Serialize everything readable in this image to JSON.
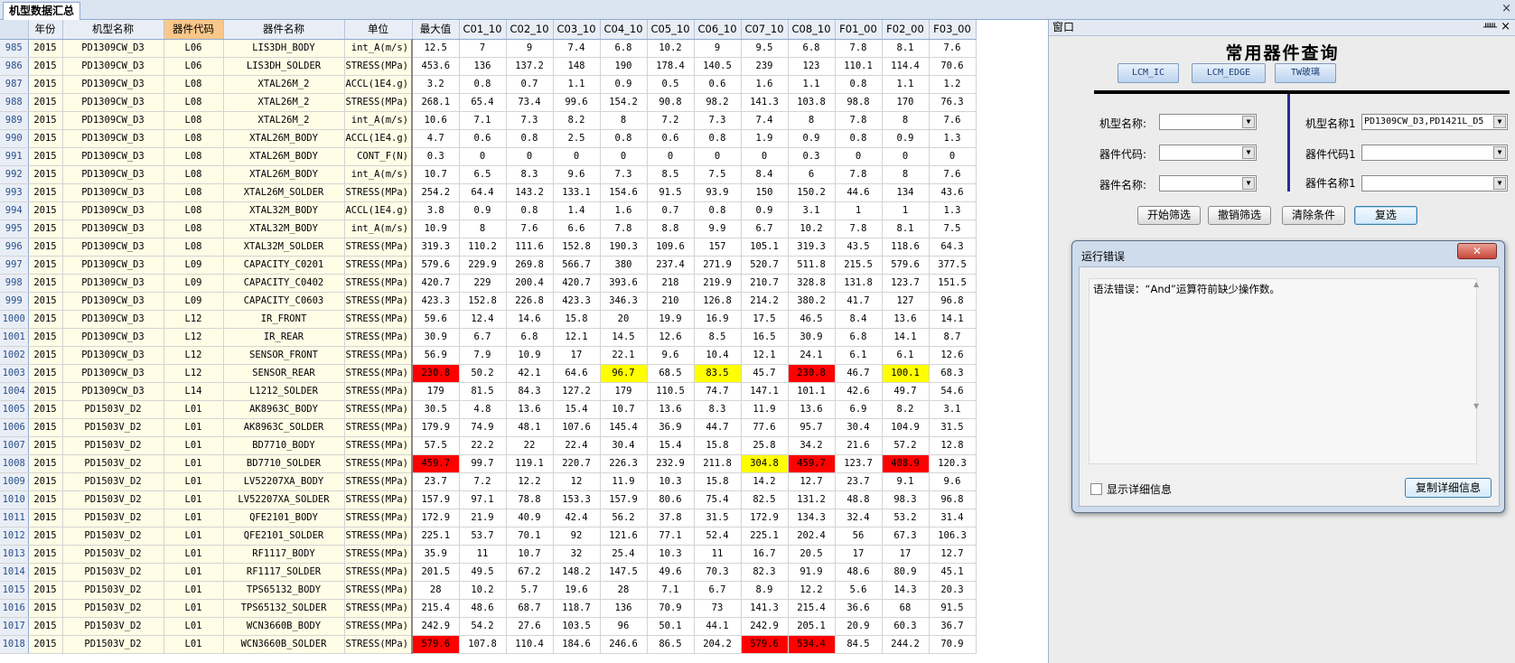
{
  "sheet_tab": "机型数据汇总",
  "columns": [
    "年份",
    "机型名称",
    "器件代码",
    "器件名称",
    "单位",
    "最大值",
    "C01_10",
    "C02_10",
    "C03_10",
    "C04_10",
    "C05_10",
    "C06_10",
    "C07_10",
    "C08_10",
    "F01_00",
    "F02_00",
    "F03_00"
  ],
  "rows": [
    {
      "n": "985",
      "c": [
        "2015",
        "PD1309CW_D3",
        "L06",
        "LIS3DH_BODY",
        "int_A(m/s)",
        "12.5",
        "7",
        "9",
        "7.4",
        "6.8",
        "10.2",
        "9",
        "9.5",
        "6.8",
        "7.8",
        "8.1",
        "7.6"
      ]
    },
    {
      "n": "986",
      "c": [
        "2015",
        "PD1309CW_D3",
        "L06",
        "LIS3DH_SOLDER",
        "STRESS(MPa)",
        "453.6",
        "136",
        "137.2",
        "148",
        "190",
        "178.4",
        "140.5",
        "239",
        "123",
        "110.1",
        "114.4",
        "70.6"
      ]
    },
    {
      "n": "987",
      "c": [
        "2015",
        "PD1309CW_D3",
        "L08",
        "XTAL26M_2",
        "ACCL(1E4.g)",
        "3.2",
        "0.8",
        "0.7",
        "1.1",
        "0.9",
        "0.5",
        "0.6",
        "1.6",
        "1.1",
        "0.8",
        "1.1",
        "1.2"
      ]
    },
    {
      "n": "988",
      "c": [
        "2015",
        "PD1309CW_D3",
        "L08",
        "XTAL26M_2",
        "STRESS(MPa)",
        "268.1",
        "65.4",
        "73.4",
        "99.6",
        "154.2",
        "90.8",
        "98.2",
        "141.3",
        "103.8",
        "98.8",
        "170",
        "76.3"
      ]
    },
    {
      "n": "989",
      "c": [
        "2015",
        "PD1309CW_D3",
        "L08",
        "XTAL26M_2",
        "int_A(m/s)",
        "10.6",
        "7.1",
        "7.3",
        "8.2",
        "8",
        "7.2",
        "7.3",
        "7.4",
        "8",
        "7.8",
        "8",
        "7.6"
      ]
    },
    {
      "n": "990",
      "c": [
        "2015",
        "PD1309CW_D3",
        "L08",
        "XTAL26M_BODY",
        "ACCL(1E4.g)",
        "4.7",
        "0.6",
        "0.8",
        "2.5",
        "0.8",
        "0.6",
        "0.8",
        "1.9",
        "0.9",
        "0.8",
        "0.9",
        "1.3"
      ]
    },
    {
      "n": "991",
      "c": [
        "2015",
        "PD1309CW_D3",
        "L08",
        "XTAL26M_BODY",
        "CONT_F(N)",
        "0.3",
        "0",
        "0",
        "0",
        "0",
        "0",
        "0",
        "0",
        "0.3",
        "0",
        "0",
        "0"
      ]
    },
    {
      "n": "992",
      "c": [
        "2015",
        "PD1309CW_D3",
        "L08",
        "XTAL26M_BODY",
        "int_A(m/s)",
        "10.7",
        "6.5",
        "8.3",
        "9.6",
        "7.3",
        "8.5",
        "7.5",
        "8.4",
        "6",
        "7.8",
        "8",
        "7.6"
      ]
    },
    {
      "n": "993",
      "c": [
        "2015",
        "PD1309CW_D3",
        "L08",
        "XTAL26M_SOLDER",
        "STRESS(MPa)",
        "254.2",
        "64.4",
        "143.2",
        "133.1",
        "154.6",
        "91.5",
        "93.9",
        "150",
        "150.2",
        "44.6",
        "134",
        "43.6"
      ]
    },
    {
      "n": "994",
      "c": [
        "2015",
        "PD1309CW_D3",
        "L08",
        "XTAL32M_BODY",
        "ACCL(1E4.g)",
        "3.8",
        "0.9",
        "0.8",
        "1.4",
        "1.6",
        "0.7",
        "0.8",
        "0.9",
        "3.1",
        "1",
        "1",
        "1.3"
      ]
    },
    {
      "n": "995",
      "c": [
        "2015",
        "PD1309CW_D3",
        "L08",
        "XTAL32M_BODY",
        "int_A(m/s)",
        "10.9",
        "8",
        "7.6",
        "6.6",
        "7.8",
        "8.8",
        "9.9",
        "6.7",
        "10.2",
        "7.8",
        "8.1",
        "7.5"
      ]
    },
    {
      "n": "996",
      "c": [
        "2015",
        "PD1309CW_D3",
        "L08",
        "XTAL32M_SOLDER",
        "STRESS(MPa)",
        "319.3",
        "110.2",
        "111.6",
        "152.8",
        "190.3",
        "109.6",
        "157",
        "105.1",
        "319.3",
        "43.5",
        "118.6",
        "64.3"
      ]
    },
    {
      "n": "997",
      "c": [
        "2015",
        "PD1309CW_D3",
        "L09",
        "CAPACITY_C0201",
        "STRESS(MPa)",
        "579.6",
        "229.9",
        "269.8",
        "566.7",
        "380",
        "237.4",
        "271.9",
        "520.7",
        "511.8",
        "215.5",
        "579.6",
        "377.5"
      ]
    },
    {
      "n": "998",
      "c": [
        "2015",
        "PD1309CW_D3",
        "L09",
        "CAPACITY_C0402",
        "STRESS(MPa)",
        "420.7",
        "229",
        "200.4",
        "420.7",
        "393.6",
        "218",
        "219.9",
        "210.7",
        "328.8",
        "131.8",
        "123.7",
        "151.5"
      ]
    },
    {
      "n": "999",
      "c": [
        "2015",
        "PD1309CW_D3",
        "L09",
        "CAPACITY_C0603",
        "STRESS(MPa)",
        "423.3",
        "152.8",
        "226.8",
        "423.3",
        "346.3",
        "210",
        "126.8",
        "214.2",
        "380.2",
        "41.7",
        "127",
        "96.8"
      ]
    },
    {
      "n": "1000",
      "c": [
        "2015",
        "PD1309CW_D3",
        "L12",
        "IR_FRONT",
        "STRESS(MPa)",
        "59.6",
        "12.4",
        "14.6",
        "15.8",
        "20",
        "19.9",
        "16.9",
        "17.5",
        "46.5",
        "8.4",
        "13.6",
        "14.1"
      ]
    },
    {
      "n": "1001",
      "c": [
        "2015",
        "PD1309CW_D3",
        "L12",
        "IR_REAR",
        "STRESS(MPa)",
        "30.9",
        "6.7",
        "6.8",
        "12.1",
        "14.5",
        "12.6",
        "8.5",
        "16.5",
        "30.9",
        "6.8",
        "14.1",
        "8.7"
      ]
    },
    {
      "n": "1002",
      "c": [
        "2015",
        "PD1309CW_D3",
        "L12",
        "SENSOR_FRONT",
        "STRESS(MPa)",
        "56.9",
        "7.9",
        "10.9",
        "17",
        "22.1",
        "9.6",
        "10.4",
        "12.1",
        "24.1",
        "6.1",
        "6.1",
        "12.6"
      ]
    },
    {
      "n": "1003",
      "c": [
        "2015",
        "PD1309CW_D3",
        "L12",
        "SENSOR_REAR",
        "STRESS(MPa)",
        "230.8",
        "50.2",
        "42.1",
        "64.6",
        "96.7",
        "68.5",
        "83.5",
        "45.7",
        "230.8",
        "46.7",
        "100.1",
        "68.3"
      ],
      "red": [
        5,
        13
      ],
      "yel": [
        9,
        11,
        15
      ]
    },
    {
      "n": "1004",
      "c": [
        "2015",
        "PD1309CW_D3",
        "L14",
        "L1212_SOLDER",
        "STRESS(MPa)",
        "179",
        "81.5",
        "84.3",
        "127.2",
        "179",
        "110.5",
        "74.7",
        "147.1",
        "101.1",
        "42.6",
        "49.7",
        "54.6"
      ]
    },
    {
      "n": "1005",
      "c": [
        "2015",
        "PD1503V_D2",
        "L01",
        "AK8963C_BODY",
        "STRESS(MPa)",
        "30.5",
        "4.8",
        "13.6",
        "15.4",
        "10.7",
        "13.6",
        "8.3",
        "11.9",
        "13.6",
        "6.9",
        "8.2",
        "3.1"
      ]
    },
    {
      "n": "1006",
      "c": [
        "2015",
        "PD1503V_D2",
        "L01",
        "AK8963C_SOLDER",
        "STRESS(MPa)",
        "179.9",
        "74.9",
        "48.1",
        "107.6",
        "145.4",
        "36.9",
        "44.7",
        "77.6",
        "95.7",
        "30.4",
        "104.9",
        "31.5"
      ]
    },
    {
      "n": "1007",
      "c": [
        "2015",
        "PD1503V_D2",
        "L01",
        "BD7710_BODY",
        "STRESS(MPa)",
        "57.5",
        "22.2",
        "22",
        "22.4",
        "30.4",
        "15.4",
        "15.8",
        "25.8",
        "34.2",
        "21.6",
        "57.2",
        "12.8"
      ]
    },
    {
      "n": "1008",
      "c": [
        "2015",
        "PD1503V_D2",
        "L01",
        "BD7710_SOLDER",
        "STRESS(MPa)",
        "459.7",
        "99.7",
        "119.1",
        "220.7",
        "226.3",
        "232.9",
        "211.8",
        "304.8",
        "459.7",
        "123.7",
        "408.9",
        "120.3"
      ],
      "red": [
        5,
        13,
        15
      ],
      "yel": [
        12
      ]
    },
    {
      "n": "1009",
      "c": [
        "2015",
        "PD1503V_D2",
        "L01",
        "LV52207XA_BODY",
        "STRESS(MPa)",
        "23.7",
        "7.2",
        "12.2",
        "12",
        "11.9",
        "10.3",
        "15.8",
        "14.2",
        "12.7",
        "23.7",
        "9.1",
        "9.6"
      ]
    },
    {
      "n": "1010",
      "c": [
        "2015",
        "PD1503V_D2",
        "L01",
        "LV52207XA_SOLDER",
        "STRESS(MPa)",
        "157.9",
        "97.1",
        "78.8",
        "153.3",
        "157.9",
        "80.6",
        "75.4",
        "82.5",
        "131.2",
        "48.8",
        "98.3",
        "96.8"
      ]
    },
    {
      "n": "1011",
      "c": [
        "2015",
        "PD1503V_D2",
        "L01",
        "QFE2101_BODY",
        "STRESS(MPa)",
        "172.9",
        "21.9",
        "40.9",
        "42.4",
        "56.2",
        "37.8",
        "31.5",
        "172.9",
        "134.3",
        "32.4",
        "53.2",
        "31.4"
      ]
    },
    {
      "n": "1012",
      "c": [
        "2015",
        "PD1503V_D2",
        "L01",
        "QFE2101_SOLDER",
        "STRESS(MPa)",
        "225.1",
        "53.7",
        "70.1",
        "92",
        "121.6",
        "77.1",
        "52.4",
        "225.1",
        "202.4",
        "56",
        "67.3",
        "106.3"
      ]
    },
    {
      "n": "1013",
      "c": [
        "2015",
        "PD1503V_D2",
        "L01",
        "RF1117_BODY",
        "STRESS(MPa)",
        "35.9",
        "11",
        "10.7",
        "32",
        "25.4",
        "10.3",
        "11",
        "16.7",
        "20.5",
        "17",
        "17",
        "12.7"
      ]
    },
    {
      "n": "1014",
      "c": [
        "2015",
        "PD1503V_D2",
        "L01",
        "RF1117_SOLDER",
        "STRESS(MPa)",
        "201.5",
        "49.5",
        "67.2",
        "148.2",
        "147.5",
        "49.6",
        "70.3",
        "82.3",
        "91.9",
        "48.6",
        "80.9",
        "45.1"
      ]
    },
    {
      "n": "1015",
      "c": [
        "2015",
        "PD1503V_D2",
        "L01",
        "TPS65132_BODY",
        "STRESS(MPa)",
        "28",
        "10.2",
        "5.7",
        "19.6",
        "28",
        "7.1",
        "6.7",
        "8.9",
        "12.2",
        "5.6",
        "14.3",
        "20.3"
      ]
    },
    {
      "n": "1016",
      "c": [
        "2015",
        "PD1503V_D2",
        "L01",
        "TPS65132_SOLDER",
        "STRESS(MPa)",
        "215.4",
        "48.6",
        "68.7",
        "118.7",
        "136",
        "70.9",
        "73",
        "141.3",
        "215.4",
        "36.6",
        "68",
        "91.5"
      ]
    },
    {
      "n": "1017",
      "c": [
        "2015",
        "PD1503V_D2",
        "L01",
        "WCN3660B_BODY",
        "STRESS(MPa)",
        "242.9",
        "54.2",
        "27.6",
        "103.5",
        "96",
        "50.1",
        "44.1",
        "242.9",
        "205.1",
        "20.9",
        "60.3",
        "36.7"
      ]
    },
    {
      "n": "1018",
      "c": [
        "2015",
        "PD1503V_D2",
        "L01",
        "WCN3660B_SOLDER",
        "STRESS(MPa)",
        "579.6",
        "107.8",
        "110.4",
        "184.6",
        "246.6",
        "86.5",
        "204.2",
        "579.6",
        "534.4",
        "84.5",
        "244.2",
        "70.9"
      ],
      "red": [
        5,
        12,
        13
      ]
    }
  ],
  "panel": {
    "title": "窗口",
    "pin": "ᚊ",
    "close": "×",
    "query_title": "常用器件查询",
    "tabs": [
      "LCM_IC",
      "LCM_EDGE",
      "TW玻璃"
    ],
    "left_fields": [
      {
        "label": "机型名称:",
        "value": ""
      },
      {
        "label": "器件代码:",
        "value": ""
      },
      {
        "label": "器件名称:",
        "value": ""
      }
    ],
    "right_fields": [
      {
        "label": "机型名称1",
        "value": "PD1309CW_D3,PD1421L_D5"
      },
      {
        "label": "器件代码1",
        "value": ""
      },
      {
        "label": "器件名称1",
        "value": ""
      }
    ],
    "actions": [
      "开始筛选",
      "撤销筛选",
      "清除条件",
      "复选"
    ],
    "dropdown_arrow": "▼"
  },
  "dialog": {
    "title": "运行错误",
    "close": "✕",
    "message": "语法错误：“And”运算符前缺少操作数。",
    "show_details": "显示详细信息",
    "copy_button": "复制详细信息"
  },
  "colors": {
    "highlight_red": "#ff0000",
    "highlight_yellow": "#ffff00",
    "selected_header": "#f9c78a",
    "frozen_fill": "#fffde6"
  }
}
